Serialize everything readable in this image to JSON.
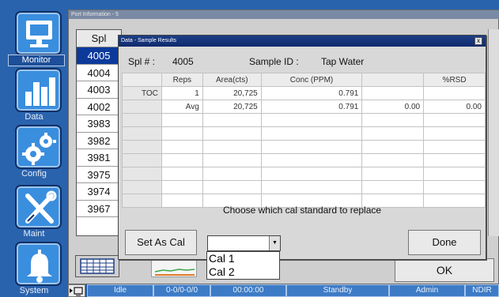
{
  "colors": {
    "accent": "#3a8ede",
    "selection": "#0c3a9b",
    "dialog_title": "#0e2a6e",
    "status_bar": "#3d7bc6"
  },
  "nav": [
    {
      "label": "Monitor",
      "icon": "monitor-icon"
    },
    {
      "label": "Data",
      "icon": "bar-chart-icon"
    },
    {
      "label": "Config",
      "icon": "gears-icon"
    },
    {
      "label": "Maint",
      "icon": "tools-icon"
    },
    {
      "label": "System",
      "icon": "bell-icon"
    }
  ],
  "port_window": {
    "title": "Port Information - 5",
    "samples_header": "Spl",
    "samples": [
      "4005",
      "4004",
      "4003",
      "4002",
      "3983",
      "3982",
      "3981",
      "3975",
      "3974",
      "3967"
    ],
    "ok_label": "OK"
  },
  "dialog": {
    "title": "Data - Sample Results",
    "close_label": "x",
    "spl_label": "Spl # :",
    "spl_value": "4005",
    "sample_id_label": "Sample ID :",
    "sample_id_value": "Tap Water",
    "columns": [
      "",
      "Reps",
      "Area(cts)",
      "Conc (PPM)",
      "",
      "%RSD",
      ""
    ],
    "rows": [
      [
        "TOC",
        "1",
        "20,725",
        "0.791",
        "",
        "",
        ""
      ],
      [
        "",
        "Avg",
        "20,725",
        "0.791",
        "0.00",
        "0.00",
        ""
      ]
    ],
    "cal_instruction": "Choose which cal standard to replace",
    "set_as_cal_label": "Set As Cal",
    "done_label": "Done",
    "cal_select_value": "",
    "cal_options": [
      "Cal 1",
      "Cal 2"
    ]
  },
  "status": {
    "state": "Idle",
    "counter": "0-0/0-0/0",
    "time": "00:00:00",
    "mode": "Standby",
    "user": "Admin",
    "detector": "NDIR"
  }
}
